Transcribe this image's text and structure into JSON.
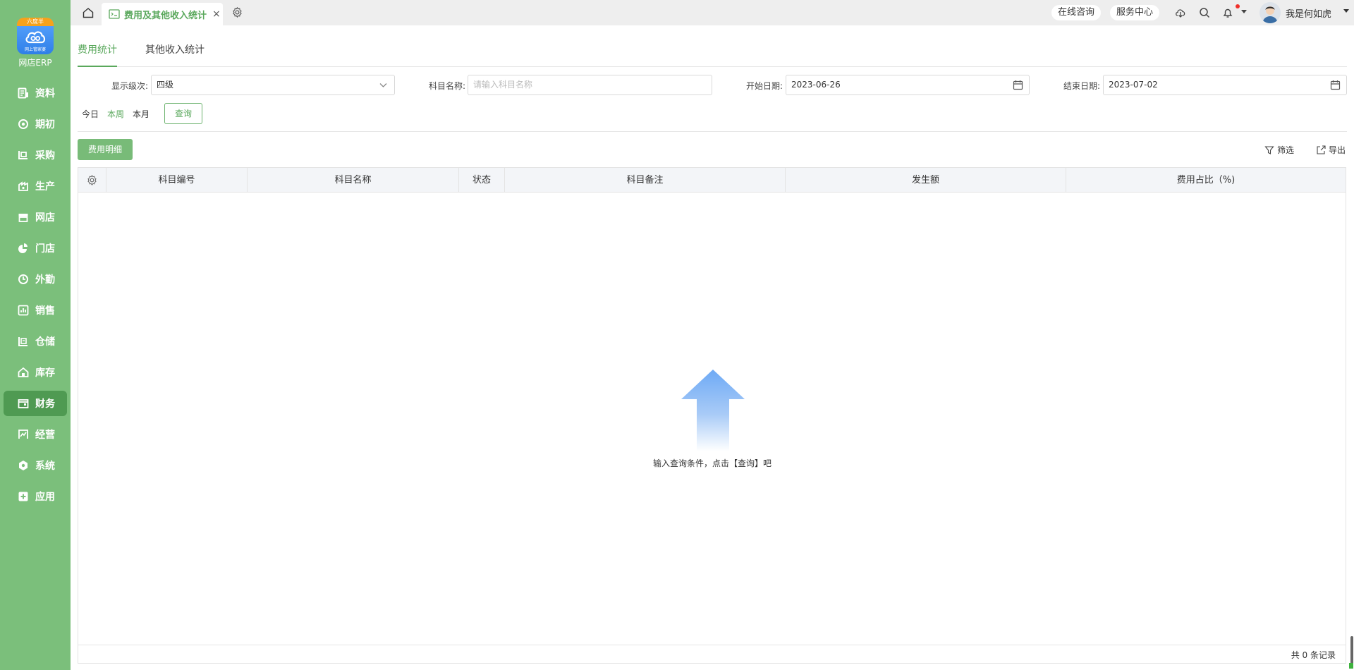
{
  "app": {
    "logo_badge": "六度半",
    "logo_subtitle": "网上管家婆",
    "name": "网店ERP"
  },
  "sidebar": {
    "items": [
      {
        "label": "资料",
        "icon": "profile-icon"
      },
      {
        "label": "期初",
        "icon": "target-icon"
      },
      {
        "label": "采购",
        "icon": "purchase-icon"
      },
      {
        "label": "生产",
        "icon": "production-icon"
      },
      {
        "label": "网店",
        "icon": "store-icon"
      },
      {
        "label": "门店",
        "icon": "pie-icon"
      },
      {
        "label": "外勤",
        "icon": "field-icon"
      },
      {
        "label": "销售",
        "icon": "sales-chart-icon"
      },
      {
        "label": "仓储",
        "icon": "warehouse-icon"
      },
      {
        "label": "库存",
        "icon": "inventory-icon"
      },
      {
        "label": "财务",
        "icon": "finance-icon"
      },
      {
        "label": "经营",
        "icon": "business-icon"
      },
      {
        "label": "系统",
        "icon": "system-icon"
      },
      {
        "label": "应用",
        "icon": "apps-icon"
      }
    ],
    "active": "财务"
  },
  "topbar": {
    "tab_label": "费用及其他收入统计",
    "tab_close": "×",
    "online_consult": "在线咨询",
    "service_center": "服务中心",
    "user_name": "我是何如虎"
  },
  "subtabs": {
    "items": [
      "费用统计",
      "其他收入统计"
    ],
    "active": "费用统计"
  },
  "filters": {
    "level_label": "显示级次:",
    "level_value": "四级",
    "subject_label": "科目名称:",
    "subject_placeholder": "请输入科目名称",
    "start_label": "开始日期:",
    "start_value": "2023-06-26",
    "end_label": "结束日期:",
    "end_value": "2023-07-02",
    "quick": [
      "今日",
      "本周",
      "本月"
    ],
    "quick_active": "本周",
    "query_button": "查询"
  },
  "toolbar": {
    "detail_button": "费用明细",
    "filter_label": "筛选",
    "export_label": "导出"
  },
  "table": {
    "columns": [
      "科目编号",
      "科目名称",
      "状态",
      "科目备注",
      "发生额",
      "费用占比（%)"
    ],
    "empty_text": "输入查询条件，点击【查询】吧",
    "total_text": "共 0 条记录"
  },
  "colors": {
    "sidebar": "#7bbf7b",
    "sidebar_active": "#4f9a52",
    "accent": "#5aa85c",
    "notification_dot": "#f0302a"
  }
}
